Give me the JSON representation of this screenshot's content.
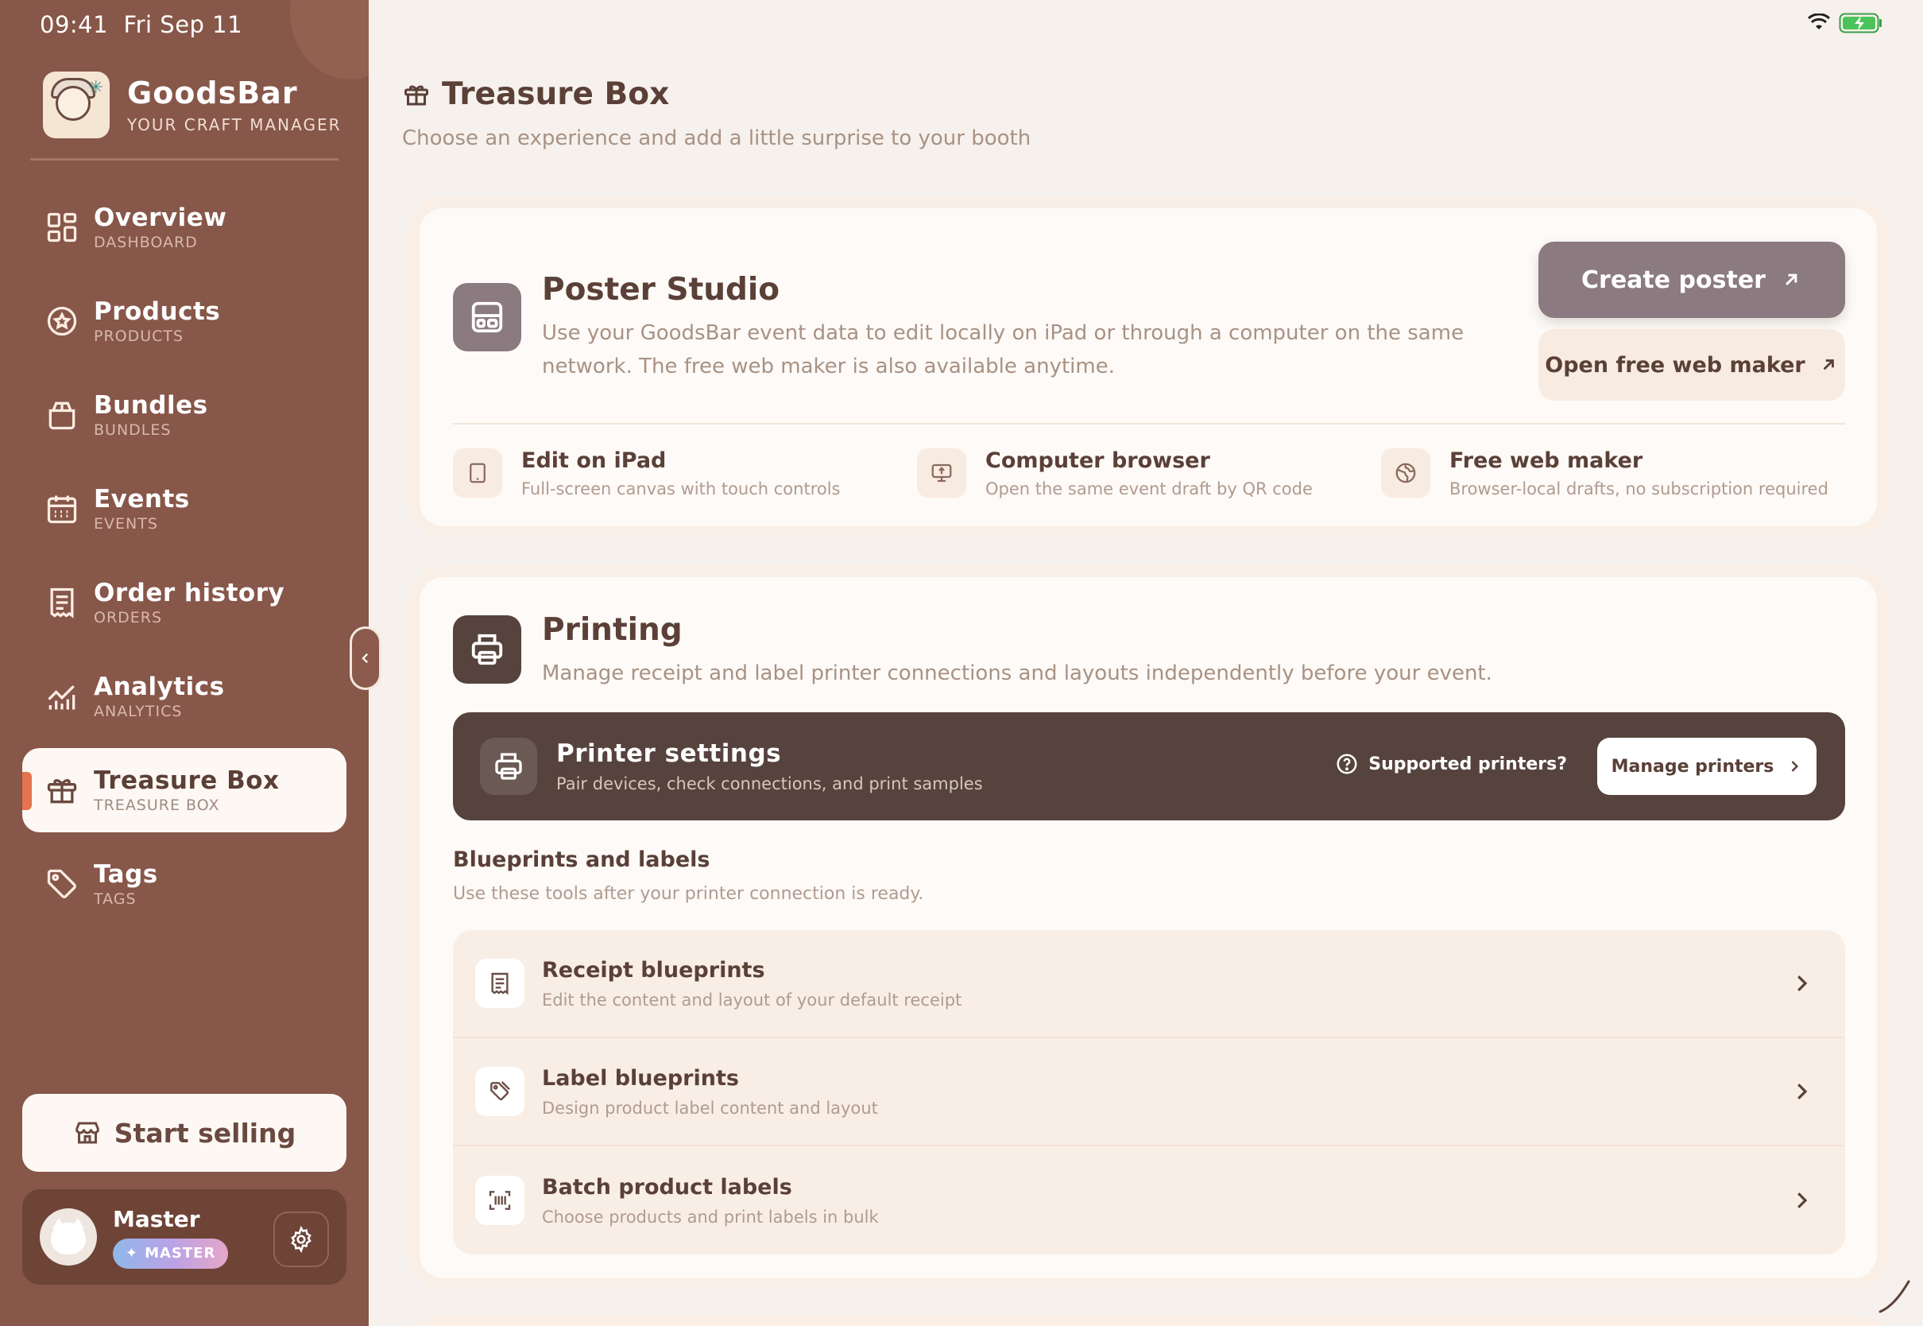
{
  "status_bar": {
    "time": "09:41",
    "date": "Fri Sep 11"
  },
  "brand": {
    "name": "GoodsBar",
    "tagline": "YOUR CRAFT MANAGER"
  },
  "nav": [
    {
      "label": "Overview",
      "sub": "DASHBOARD",
      "icon": "grid-icon"
    },
    {
      "label": "Products",
      "sub": "PRODUCTS",
      "icon": "star-badge-icon"
    },
    {
      "label": "Bundles",
      "sub": "BUNDLES",
      "icon": "box-icon"
    },
    {
      "label": "Events",
      "sub": "EVENTS",
      "icon": "calendar-icon"
    },
    {
      "label": "Order history",
      "sub": "ORDERS",
      "icon": "receipt-icon"
    },
    {
      "label": "Analytics",
      "sub": "ANALYTICS",
      "icon": "chart-icon"
    },
    {
      "label": "Treasure Box",
      "sub": "TREASURE BOX",
      "icon": "gift-icon",
      "active": true
    },
    {
      "label": "Tags",
      "sub": "TAGS",
      "icon": "tag-icon"
    }
  ],
  "start_selling": "Start selling",
  "profile": {
    "name": "Master",
    "badge": "MASTER"
  },
  "page": {
    "title": "Treasure Box",
    "subtitle": "Choose an experience and add a little surprise to your booth"
  },
  "poster_studio": {
    "title": "Poster Studio",
    "description": "Use your GoodsBar event data to edit locally on iPad or through a computer on the same network. The free web maker is also available anytime.",
    "create_button": "Create poster",
    "open_button": "Open free web maker",
    "features": [
      {
        "title": "Edit on iPad",
        "sub": "Full-screen canvas with touch controls",
        "icon": "tablet-icon"
      },
      {
        "title": "Computer browser",
        "sub": "Open the same event draft by QR code",
        "icon": "monitor-upload-icon"
      },
      {
        "title": "Free web maker",
        "sub": "Browser-local drafts, no subscription required",
        "icon": "globe-icon"
      }
    ]
  },
  "printing": {
    "title": "Printing",
    "description": "Manage receipt and label printer connections and layouts independently before your event.",
    "printer_settings": {
      "title": "Printer settings",
      "sub": "Pair devices, check connections, and print samples",
      "help": "Supported printers?",
      "manage": "Manage printers"
    },
    "blueprints": {
      "title": "Blueprints and labels",
      "sub": "Use these tools after your printer connection is ready.",
      "items": [
        {
          "title": "Receipt blueprints",
          "sub": "Edit the content and layout of your default receipt",
          "icon": "receipt-icon"
        },
        {
          "title": "Label blueprints",
          "sub": "Design product label content and layout",
          "icon": "tags-icon"
        },
        {
          "title": "Batch product labels",
          "sub": "Choose products and print labels in bulk",
          "icon": "barcode-scan-icon"
        }
      ]
    }
  },
  "colors": {
    "sidebar": "#87574a",
    "accent": "#e2744f",
    "poster_button": "#8b7a80",
    "dark_panel": "#56433d",
    "background": "#f6f1ec"
  }
}
